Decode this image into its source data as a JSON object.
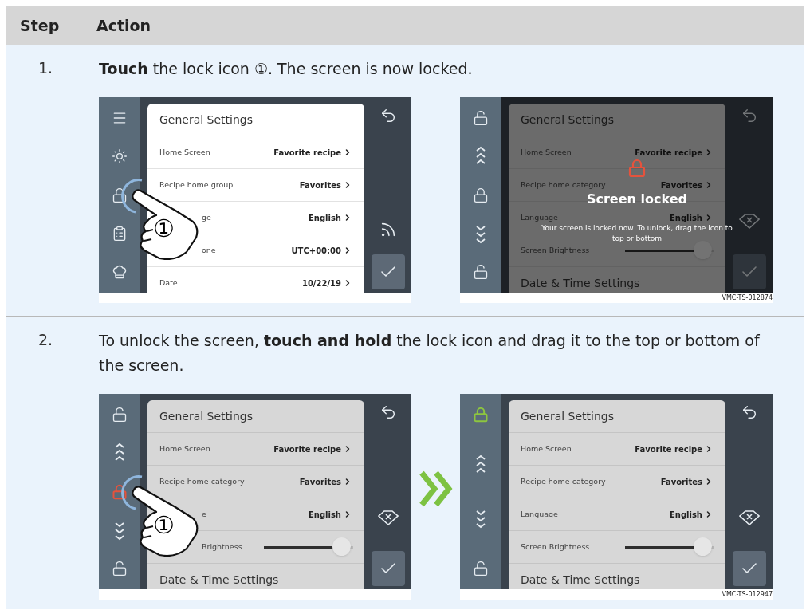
{
  "header": {
    "step": "Step",
    "action": "Action"
  },
  "steps": [
    {
      "number": "1.",
      "instruction": "**Touch** the lock icon ①. The screen is now locked.",
      "transition_arrow": false,
      "figures": [
        {
          "sidebar": [
            {
              "kind": "menu"
            },
            {
              "kind": "sun"
            },
            {
              "kind": "lock"
            },
            {
              "kind": "clipboard"
            },
            {
              "kind": "chef-hat"
            }
          ],
          "card": {
            "dimmed": false,
            "title": "General Settings",
            "rows": [
              {
                "kind": "link",
                "label": "Home Screen",
                "value": "Favorite recipe"
              },
              {
                "kind": "link",
                "label": "Recipe home group",
                "value": "Favorites"
              },
              {
                "kind": "link",
                "label": "ge",
                "value": "English",
                "covered": true
              },
              {
                "kind": "link",
                "label": "one",
                "value": "UTC+00:00",
                "covered": true
              },
              {
                "kind": "link",
                "label": "Date",
                "value": "10/22/19"
              }
            ]
          },
          "right": [
            {
              "kind": "back"
            },
            {
              "kind": "signal"
            },
            {
              "kind": "confirm"
            }
          ],
          "touch": {
            "marker": "①"
          }
        },
        {
          "sidebar": [
            {
              "kind": "lock-open"
            },
            {
              "kind": "chevrons-up"
            },
            {
              "kind": "lock"
            },
            {
              "kind": "chevrons-down"
            },
            {
              "kind": "lock-open"
            }
          ],
          "card": {
            "dimmed": true,
            "title": "General Settings",
            "rows": [
              {
                "kind": "link",
                "label": "Home Screen",
                "value": "Favorite recipe"
              },
              {
                "kind": "link",
                "label": "Recipe home category",
                "value": "Favorites"
              },
              {
                "kind": "link",
                "label": "Language",
                "value": "English"
              },
              {
                "kind": "slider",
                "label": "Screen Brightness",
                "level": 0.97
              }
            ],
            "section": "Date & Time Settings"
          },
          "right": [
            {
              "kind": "back"
            },
            {
              "kind": "clear"
            },
            {
              "kind": "confirm"
            }
          ],
          "lock_overlay": {
            "title": "Screen locked",
            "message": "Your screen is locked now. To unlock, drag the icon to top or bottom"
          },
          "caption": "VMC-TS-012874"
        }
      ]
    },
    {
      "number": "2.",
      "instruction": "To unlock the screen, **touch and hold** the lock icon and drag it to the top or bottom of the screen.",
      "transition_arrow": true,
      "figures": [
        {
          "sidebar": [
            {
              "kind": "lock-open"
            },
            {
              "kind": "chevrons-up"
            },
            {
              "kind": "lock",
              "color": "#e5533d"
            },
            {
              "kind": "chevrons-down"
            },
            {
              "kind": "lock-open"
            }
          ],
          "card": {
            "dimmed": true,
            "title": "General Settings",
            "rows": [
              {
                "kind": "link",
                "label": "Home Screen",
                "value": "Favorite recipe"
              },
              {
                "kind": "link",
                "label": "Recipe home category",
                "value": "Favorites"
              },
              {
                "kind": "link",
                "label": "e",
                "value": "English",
                "covered": true
              },
              {
                "kind": "slider",
                "label": "Brightness",
                "level": 0.97,
                "covered": true
              }
            ],
            "section": "Date & Time Settings"
          },
          "right": [
            {
              "kind": "back"
            },
            {
              "kind": "clear"
            },
            {
              "kind": "confirm"
            }
          ],
          "touch": {
            "marker": "①"
          }
        },
        {
          "sidebar": [
            {
              "kind": "lock",
              "color": "#8dc63f"
            },
            {
              "kind": "chevrons-up"
            },
            {
              "kind": "chevrons-down"
            },
            {
              "kind": "lock-open"
            }
          ],
          "card": {
            "dimmed": true,
            "title": "General Settings",
            "rows": [
              {
                "kind": "link",
                "label": "Home Screen",
                "value": "Favorite recipe"
              },
              {
                "kind": "link",
                "label": "Recipe home category",
                "value": "Favorites"
              },
              {
                "kind": "link",
                "label": "Language",
                "value": "English"
              },
              {
                "kind": "slider",
                "label": "Screen Brightness",
                "level": 0.97
              }
            ],
            "section": "Date & Time Settings"
          },
          "right": [
            {
              "kind": "back"
            },
            {
              "kind": "clear"
            },
            {
              "kind": "confirm"
            }
          ],
          "caption": "VMC-TS-012947"
        }
      ]
    }
  ]
}
